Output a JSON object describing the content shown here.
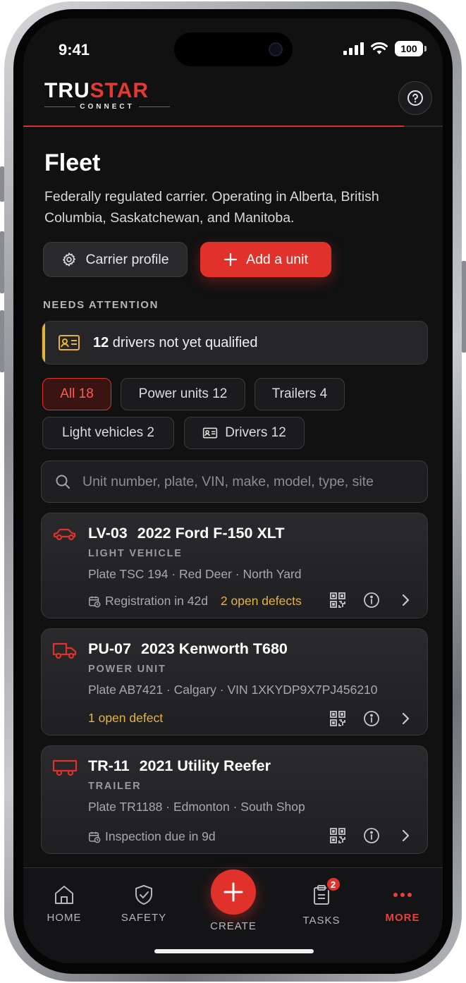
{
  "status_bar": {
    "time": "9:41",
    "battery": "100"
  },
  "brand": {
    "name_white": "TRU",
    "name_red": "STAR",
    "sub": "CONNECT"
  },
  "page": {
    "title": "Fleet",
    "description": "Federally regulated carrier. Operating in Alberta, British Columbia, Saskatchewan, and Manitoba."
  },
  "actions": {
    "carrier_profile": "Carrier profile",
    "add_unit": "Add a unit"
  },
  "attention": {
    "label": "NEEDS ATTENTION",
    "count": "12",
    "text": " drivers not yet qualified",
    "accent": "#e3b23c"
  },
  "filters": [
    {
      "label": "All 18",
      "active": true
    },
    {
      "label": "Power units 12",
      "active": false
    },
    {
      "label": "Trailers 4",
      "active": false
    },
    {
      "label": "Light vehicles 2",
      "active": false
    },
    {
      "label": "Drivers 12",
      "active": false,
      "icon": "id-card-icon"
    }
  ],
  "search": {
    "placeholder": "Unit number, plate, VIN, make, model, type, site",
    "value": ""
  },
  "units": [
    {
      "id": "LV-03",
      "name": "2022 Ford F-150 XLT",
      "type": "LIGHT VEHICLE",
      "meta": "Plate TSC 194 · Red Deer · North Yard",
      "status": "Registration in 42d",
      "warning": "2 open defects",
      "icon": "car-icon"
    },
    {
      "id": "PU-07",
      "name": "2023 Kenworth T680",
      "type": "POWER UNIT",
      "meta": "Plate AB7421 · Calgary · VIN 1XKYDP9X7PJ456210",
      "status": "",
      "warning": "1 open defect",
      "icon": "truck-icon"
    },
    {
      "id": "TR-11",
      "name": "2021 Utility Reefer",
      "type": "TRAILER",
      "meta": "Plate TR1188 · Edmonton · South Shop",
      "status": "Inspection due in 9d",
      "warning": "",
      "icon": "trailer-icon"
    }
  ],
  "nav": {
    "home": "HOME",
    "safety": "SAFETY",
    "create": "CREATE",
    "tasks": "TASKS",
    "tasks_badge": "2",
    "more": "MORE"
  },
  "colors": {
    "accent": "#e0322b",
    "warning": "#e8b339",
    "background": "#111112"
  }
}
